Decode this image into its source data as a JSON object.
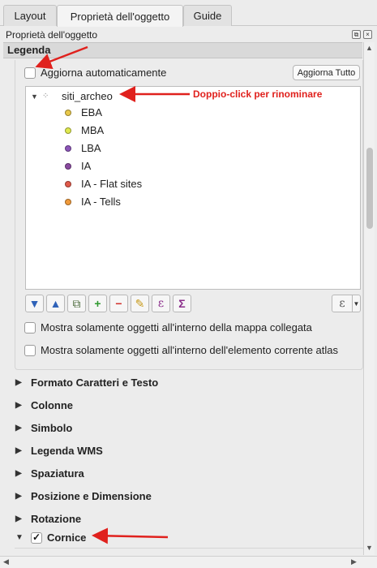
{
  "tabs": [
    {
      "label": "Layout",
      "active": false
    },
    {
      "label": "Proprietà dell'oggetto",
      "active": true
    },
    {
      "label": "Guide",
      "active": false
    }
  ],
  "dock": {
    "title": "Proprietà dell'oggetto"
  },
  "section": {
    "title": "Legenda"
  },
  "auto_update": {
    "label": "Aggiorna automaticamente",
    "checked": false
  },
  "update_all_button": "Aggiorna Tutto",
  "tree": {
    "root": "siti_archeo",
    "items": [
      {
        "label": "EBA",
        "color": "#e8c84a"
      },
      {
        "label": "MBA",
        "color": "#dfe94e"
      },
      {
        "label": "LBA",
        "color": "#8c55b8"
      },
      {
        "label": "IA",
        "color": "#8a4aa0"
      },
      {
        "label": "IA - Flat sites",
        "color": "#e05a4a"
      },
      {
        "label": "IA - Tells",
        "color": "#f09a3a"
      }
    ]
  },
  "toolbar": {
    "icons": [
      "move-down-icon",
      "move-up-icon",
      "add-group-icon",
      "add-item-icon",
      "remove-item-icon",
      "edit-icon",
      "expression-icon",
      "count-icon"
    ],
    "glyphs": [
      "▼",
      "▲",
      "⧉",
      "+",
      "−",
      "✎",
      "ε",
      "Σ"
    ],
    "expr_glyph": "ε"
  },
  "options": {
    "only_linked_map": "Mostra solamente oggetti  all'interno della mappa collegata",
    "only_atlas": "Mostra solamente oggetti all'interno dell'elemento corrente atlas"
  },
  "sections": [
    "Formato Caratteri e Testo",
    "Colonne",
    "Simbolo",
    "Legenda WMS",
    "Spaziatura",
    "Posizione e Dimensione",
    "Rotazione"
  ],
  "frame_section": {
    "label": "Cornice",
    "checked": true
  },
  "annotation": {
    "rename_hint": "Doppio-click per rinominare"
  },
  "colors": {
    "annotation": "#e0211d"
  }
}
